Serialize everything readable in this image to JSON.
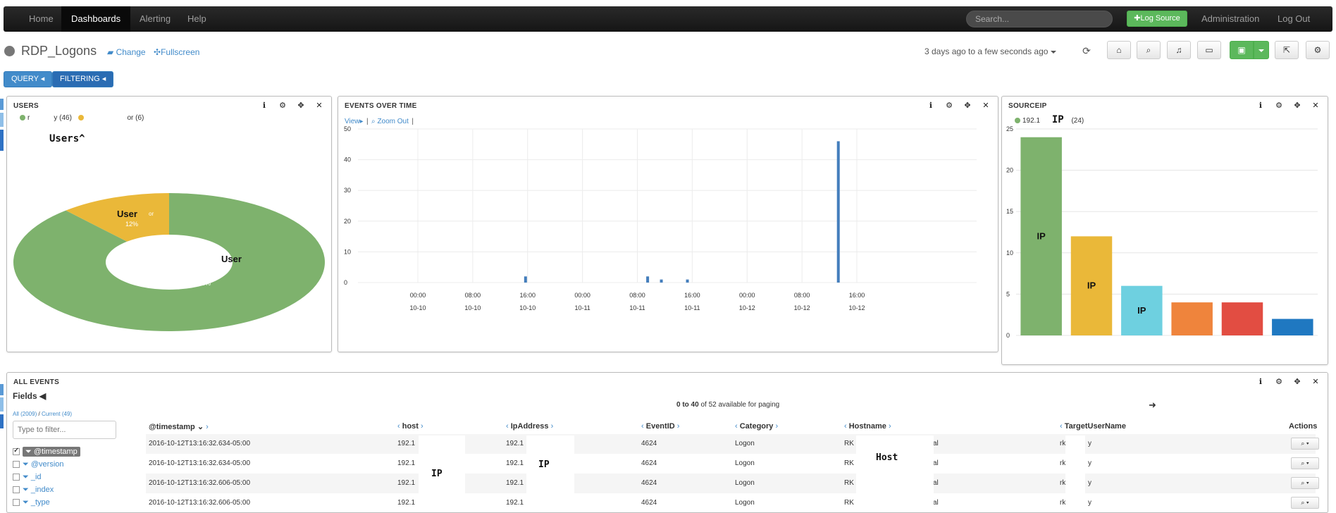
{
  "navbar": {
    "items": [
      {
        "label": "Home"
      },
      {
        "label": "Dashboards"
      },
      {
        "label": "Alerting"
      },
      {
        "label": "Help"
      }
    ],
    "search_placeholder": "Search...",
    "log_source_label": "Log Source",
    "administration_label": "Administration",
    "logout_label": "Log Out"
  },
  "header": {
    "title": "RDP_Logons",
    "change_label": "Change",
    "fullscreen_label": "Fullscreen",
    "timerange": "3 days ago to a few seconds ago"
  },
  "toolbar": {
    "query_label": "QUERY",
    "filtering_label": "FILTERING"
  },
  "users_panel": {
    "title": "USERS",
    "legend": [
      {
        "label_a": "r",
        "label_b": "y (46)",
        "color": "#7eb26d"
      },
      {
        "label_a": "",
        "label_b": "or (6)",
        "color": "#eab839"
      }
    ],
    "overlay_title": "Users^",
    "slices": [
      {
        "name_overlay": "User",
        "sub": "rk",
        "sub2": "y",
        "value": 46,
        "percent": "88%",
        "color": "#7eb26d"
      },
      {
        "name_overlay": "User",
        "sub": "or",
        "value": 6,
        "percent": "12%",
        "color": "#eab839"
      }
    ]
  },
  "events_panel": {
    "title": "EVENTS OVER TIME",
    "view_label": "View",
    "zoom_out_label": "Zoom Out"
  },
  "sourceip_panel": {
    "title": "SOURCEIP",
    "legend_label": "192.1",
    "legend_overlay": "IP",
    "legend_count": "(24)",
    "legend_color": "#7eb26d",
    "bar_overlay": "IP"
  },
  "chart_data": [
    {
      "type": "pie",
      "title": "USERS",
      "labels": [
        "r…y",
        "…or"
      ],
      "values": [
        46,
        6
      ],
      "percent_labels": [
        "88%",
        "12%"
      ],
      "colors": [
        "#7eb26d",
        "#eab839"
      ],
      "donut": true
    },
    {
      "type": "bar",
      "title": "EVENTS OVER TIME",
      "ylim": [
        0,
        50
      ],
      "yticks": [
        0,
        10,
        20,
        30,
        40,
        50
      ],
      "xticks": [
        {
          "time": "00:00",
          "date": "10-10",
          "hours": 0
        },
        {
          "time": "08:00",
          "date": "10-10",
          "hours": 8
        },
        {
          "time": "16:00",
          "date": "10-10",
          "hours": 16
        },
        {
          "time": "00:00",
          "date": "10-11",
          "hours": 24
        },
        {
          "time": "08:00",
          "date": "10-11",
          "hours": 32
        },
        {
          "time": "16:00",
          "date": "10-11",
          "hours": 40
        },
        {
          "time": "00:00",
          "date": "10-12",
          "hours": 48
        },
        {
          "time": "08:00",
          "date": "10-12",
          "hours": 56
        },
        {
          "time": "16:00",
          "date": "10-12",
          "hours": 64
        }
      ],
      "bars": [
        {
          "hours": 15.7,
          "value": 2
        },
        {
          "hours": 33.5,
          "value": 2
        },
        {
          "hours": 35.5,
          "value": 1
        },
        {
          "hours": 39.3,
          "value": 1
        },
        {
          "hours": 61.3,
          "value": 46
        }
      ],
      "grid": true,
      "color": "#447ebc"
    },
    {
      "type": "bar",
      "title": "SOURCEIP",
      "ylim": [
        0,
        25
      ],
      "yticks": [
        0,
        5,
        10,
        15,
        20,
        25
      ],
      "values": [
        24,
        12,
        6,
        4,
        4,
        2
      ],
      "colors": [
        "#7eb26d",
        "#eab839",
        "#6ed0e0",
        "#ef843c",
        "#e24d42",
        "#1f78c1"
      ],
      "grid": true
    }
  ],
  "all_events": {
    "title": "ALL EVENTS",
    "fields_label": "Fields",
    "all_label": "All (2009)",
    "slash": "/",
    "current_label": "Current (49)",
    "filter_placeholder": "Type to filter...",
    "fields": [
      "@timestamp",
      "@version",
      "_id",
      "_index",
      "_type"
    ],
    "paging_range": "0 to 40",
    "paging_rest": "of 52 available for paging",
    "columns": [
      "@timestamp",
      "host",
      "IpAddress",
      "EventID",
      "Category",
      "Hostname",
      "TargetUserName",
      "Actions"
    ],
    "overlay_ip": "IP",
    "overlay_host": "Host",
    "rows": [
      {
        "timestamp": "2016-10-12T13:16:32.634-05:00",
        "host": "192.1",
        "ip": "192.1",
        "eventid": "4624",
        "category": "Logon",
        "hostname_a": "RK",
        "hostname_b": "al",
        "user_a": "rk",
        "user_b": "y"
      },
      {
        "timestamp": "2016-10-12T13:16:32.634-05:00",
        "host": "192.1",
        "ip": "192.1",
        "eventid": "4624",
        "category": "Logon",
        "hostname_a": "RK",
        "hostname_b": "al",
        "user_a": "rk",
        "user_b": "y"
      },
      {
        "timestamp": "2016-10-12T13:16:32.606-05:00",
        "host": "192.1",
        "ip": "192.1",
        "eventid": "4624",
        "category": "Logon",
        "hostname_a": "RK",
        "hostname_b": "al",
        "user_a": "rk",
        "user_b": "y"
      },
      {
        "timestamp": "2016-10-12T13:16:32.606-05:00",
        "host": "192.1",
        "ip": "192.1",
        "eventid": "4624",
        "category": "Logon",
        "hostname_a": "RK",
        "hostname_b": "al",
        "user_a": "rk",
        "user_b": "y"
      }
    ]
  }
}
